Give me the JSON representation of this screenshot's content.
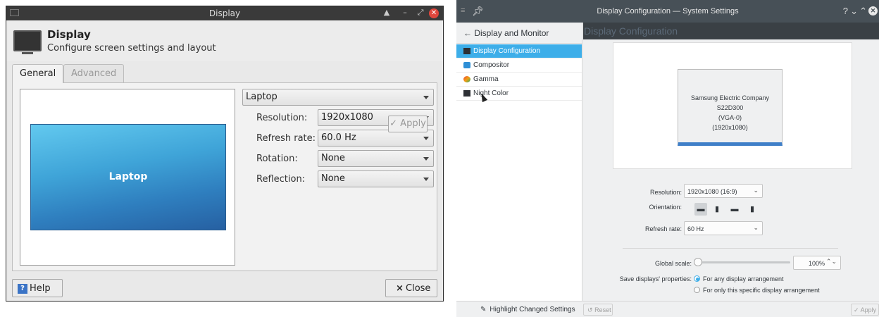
{
  "xfce": {
    "window_title": "Display",
    "header_title": "Display",
    "header_subtitle": "Configure screen settings and layout",
    "tabs": [
      "General",
      "Advanced"
    ],
    "preview_label": "Laptop",
    "output_select": "Laptop",
    "fields": [
      {
        "label": "Resolution:",
        "value": "1920x1080"
      },
      {
        "label": "Refresh rate:",
        "value": "60.0 Hz"
      },
      {
        "label": "Rotation:",
        "value": "None"
      },
      {
        "label": "Reflection:",
        "value": "None"
      }
    ],
    "apply_label": "Apply",
    "help_label": "Help",
    "close_label": "Close",
    "close_mark": "×",
    "apply_mark": "✓",
    "help_mark": "?",
    "accent_color": "#3b74c6"
  },
  "kde": {
    "window_title": "Display Configuration — System Settings",
    "sidebar_header": "Display and Monitor",
    "sidebar_back_arrow": "←",
    "sidebar_items": [
      {
        "label": "Display Configuration",
        "icon": "monitor-icon",
        "active": true
      },
      {
        "label": "Compositor",
        "icon": "compositor-icon",
        "active": false
      },
      {
        "label": "Gamma",
        "icon": "gamma-icon",
        "active": false
      },
      {
        "label": "Night Color",
        "icon": "night-color-icon",
        "active": false
      }
    ],
    "page_title": "Display Configuration",
    "monitor": {
      "name": "Samsung Electric Company S22D300",
      "connector": "(VGA-0)",
      "resolution": "(1920x1080)"
    },
    "resolution_label": "Resolution:",
    "resolution_value": "1920x1080 (16:9)",
    "orientation_label": "Orientation:",
    "refresh_label": "Refresh rate:",
    "refresh_value": "60 Hz",
    "global_scale_label": "Global scale:",
    "global_scale_value": "100%",
    "global_scale_fraction": 0.0,
    "save_label": "Save displays' properties:",
    "save_options": [
      "For any display arrangement",
      "For only this specific display arrangement"
    ],
    "save_selected_index": 0,
    "highlight_label": "Highlight Changed Settings",
    "reset_label": "Reset",
    "apply_label": "Apply",
    "accent_color": "#3daee9"
  }
}
